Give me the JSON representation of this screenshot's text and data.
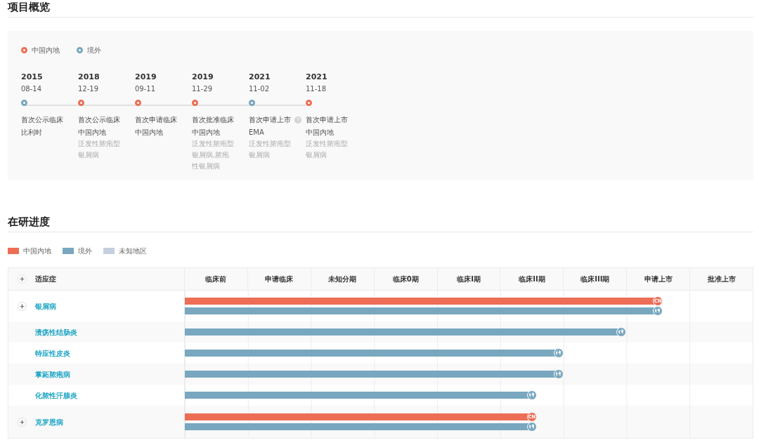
{
  "overview": {
    "title": "项目概览",
    "legend": [
      {
        "label": "中国内地",
        "color": "#ed6d55"
      },
      {
        "label": "境外",
        "color": "#78a7bf"
      }
    ],
    "milestones": [
      {
        "year": "2015",
        "date": "08-14",
        "color": "#78a7bf",
        "event": "首次公示临床",
        "info_icon": false,
        "region": "比利时"
      },
      {
        "year": "2018",
        "date": "12-19",
        "color": "#ed6d55",
        "event": "首次公示临床",
        "info_icon": false,
        "region": "中国内地",
        "detail": "泛发性脓疱型银屑病"
      },
      {
        "year": "2019",
        "date": "09-11",
        "color": "#ed6d55",
        "event": "首次申请临床",
        "info_icon": false,
        "region": "中国内地"
      },
      {
        "year": "2019",
        "date": "11-29",
        "color": "#ed6d55",
        "event": "首次批准临床",
        "info_icon": false,
        "region": "中国内地",
        "detail": "泛发性脓疱型银屑病,脓疱性银屑病"
      },
      {
        "year": "2021",
        "date": "11-02",
        "color": "#78a7bf",
        "event": "首次申请上市",
        "info_icon": true,
        "region": "EMA",
        "detail": "泛发性脓疱型银屑病"
      },
      {
        "year": "2021",
        "date": "11-18",
        "color": "#ed6d55",
        "event": "首次申请上市",
        "info_icon": false,
        "region": "中国内地",
        "detail": "泛发性脓疱型银屑病"
      }
    ]
  },
  "progress": {
    "title": "在研进度",
    "legend": [
      {
        "label": "中国内地",
        "color": "#ed6d55"
      },
      {
        "label": "境外",
        "color": "#78a7bf"
      },
      {
        "label": "未知地区",
        "color": "#c5cfdf"
      }
    ],
    "table": {
      "columns": [
        "适应症",
        "临床前",
        "申请临床",
        "未知分期",
        "临床0期",
        "临床I期",
        "临床II期",
        "临床III期",
        "申请上市",
        "批准上市"
      ],
      "rows": [
        {
          "indication": "银屑病",
          "expandable": true,
          "bars": [
            {
              "kind": "cn",
              "color": "#ed6d55",
              "level": 0.833,
              "badge": "CN"
            },
            {
              "kind": "global",
              "color": "#78a7bf",
              "level": 0.833
            }
          ]
        },
        {
          "indication": "溃疡性结肠炎",
          "expandable": false,
          "bars": [
            {
              "kind": "global",
              "color": "#78a7bf",
              "level": 0.769
            }
          ]
        },
        {
          "indication": "特应性皮炎",
          "expandable": false,
          "bars": [
            {
              "kind": "global",
              "color": "#78a7bf",
              "level": 0.659
            }
          ]
        },
        {
          "indication": "掌跖脓疱病",
          "expandable": false,
          "bars": [
            {
              "kind": "global",
              "color": "#78a7bf",
              "level": 0.659
            }
          ]
        },
        {
          "indication": "化脓性汗腺炎",
          "expandable": false,
          "bars": [
            {
              "kind": "global",
              "color": "#78a7bf",
              "level": 0.611
            }
          ]
        },
        {
          "indication": "克罗恩病",
          "expandable": true,
          "bars": [
            {
              "kind": "cn",
              "color": "#ed6d55",
              "level": 0.611,
              "badge": "CN"
            },
            {
              "kind": "global",
              "color": "#78a7bf",
              "level": 0.611
            }
          ]
        }
      ]
    }
  }
}
